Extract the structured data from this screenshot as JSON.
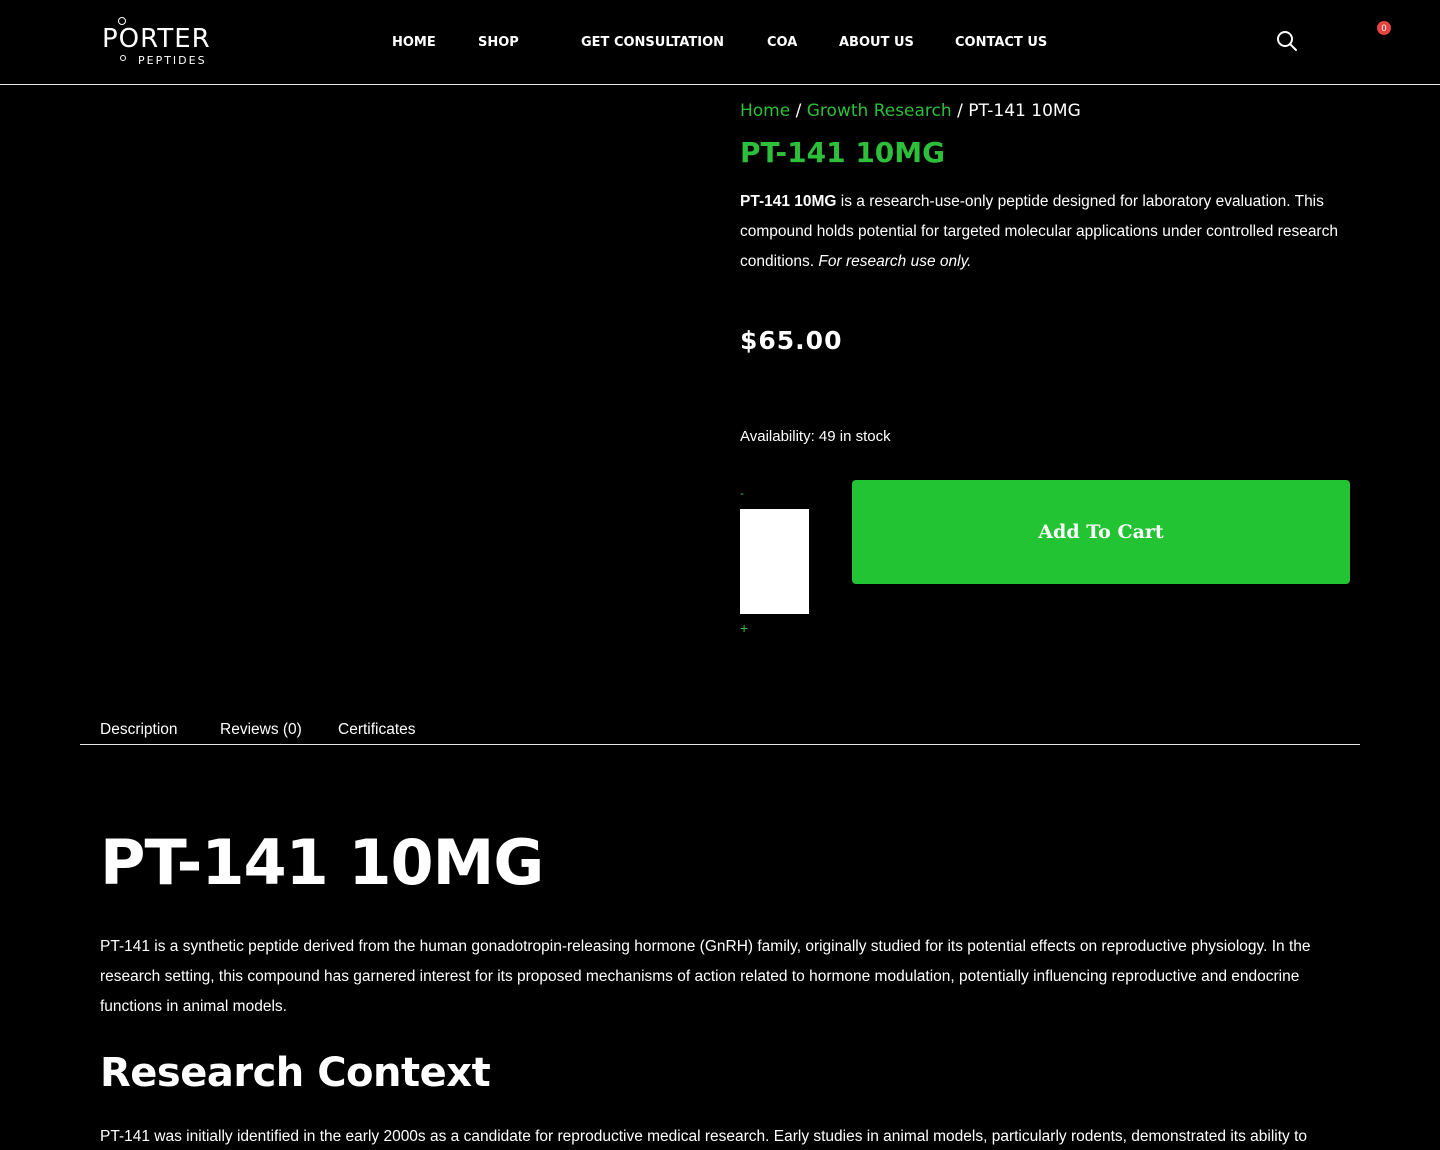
{
  "header": {
    "logo": {
      "main": "PORTER",
      "sub": "PEPTIDES"
    },
    "nav": [
      "HOME",
      "SHOP",
      "GET CONSULTATION",
      "COA",
      "ABOUT US",
      "CONTACT US"
    ],
    "search_icon": "search-icon",
    "cart_count": "0",
    "badge_color": "#e2443f"
  },
  "breadcrumb": {
    "home": "Home",
    "sep1": " / ",
    "category": "Growth Research",
    "sep2": " / ",
    "current": "PT-141 10MG"
  },
  "product": {
    "title": "PT-141 10MG",
    "desc_bold": "PT-141 10MG",
    "desc_text": " is a research-use-only peptide designed for laboratory evaluation. This compound holds potential for targeted molecular applications under controlled research conditions. ",
    "desc_italic": "For research use only.",
    "price": "$65.00",
    "availability": "Availability: 49 in stock",
    "qty_minus": "-",
    "qty_plus": "+",
    "qty_value": "",
    "add_to_cart": "Add To Cart",
    "accent_color": "#2ebf3a",
    "button_color": "#22c433"
  },
  "tabs": [
    "Description",
    "Reviews (0)",
    "Certificates"
  ],
  "description": {
    "heading": "PT-141 10MG",
    "paragraph": "PT-141 is a synthetic peptide derived from the human gonadotropin-releasing hormone (GnRH) family, originally studied for its potential effects on reproductive physiology. In the research setting, this compound has garnered interest for its proposed mechanisms of action related to hormone modulation, potentially influencing reproductive and endocrine functions in animal models.",
    "section_heading": "Research Context",
    "section_paragraph": "PT-141 was initially identified in the early 2000s as a candidate for reproductive medical research. Early studies in animal models, particularly rodents, demonstrated its ability to"
  }
}
